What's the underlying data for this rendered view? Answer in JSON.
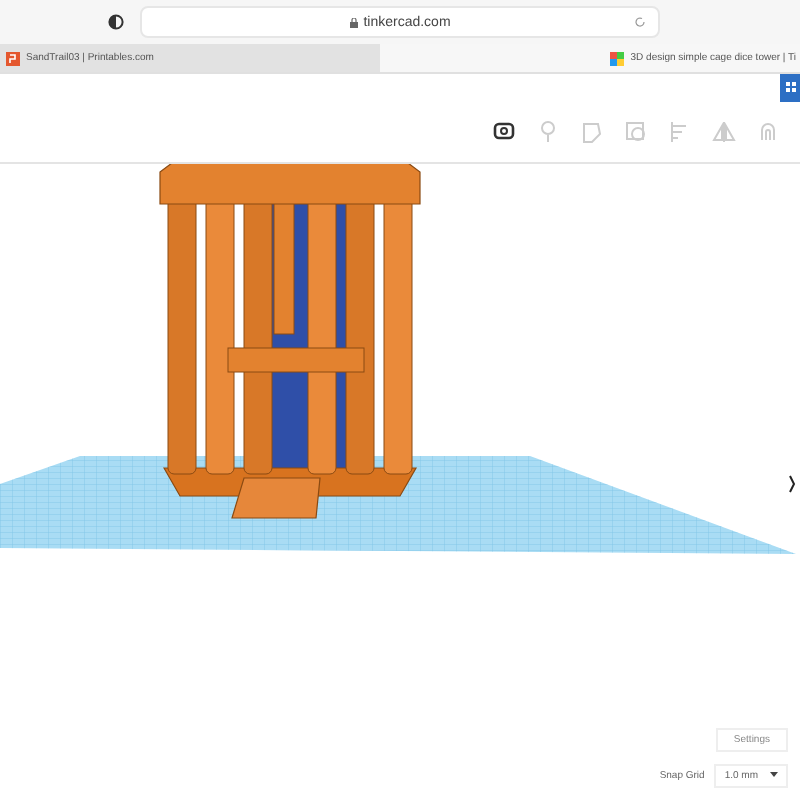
{
  "browser": {
    "url": "tinkercad.com"
  },
  "tabs": [
    {
      "label": "SandTrail03 | Printables.com",
      "selected": false
    },
    {
      "label": "3D design simple cage dice tower | Ti",
      "selected": true
    }
  ],
  "settings_button": "Settings",
  "snap_grid": {
    "label": "Snap Grid",
    "value": "1.0 mm"
  }
}
